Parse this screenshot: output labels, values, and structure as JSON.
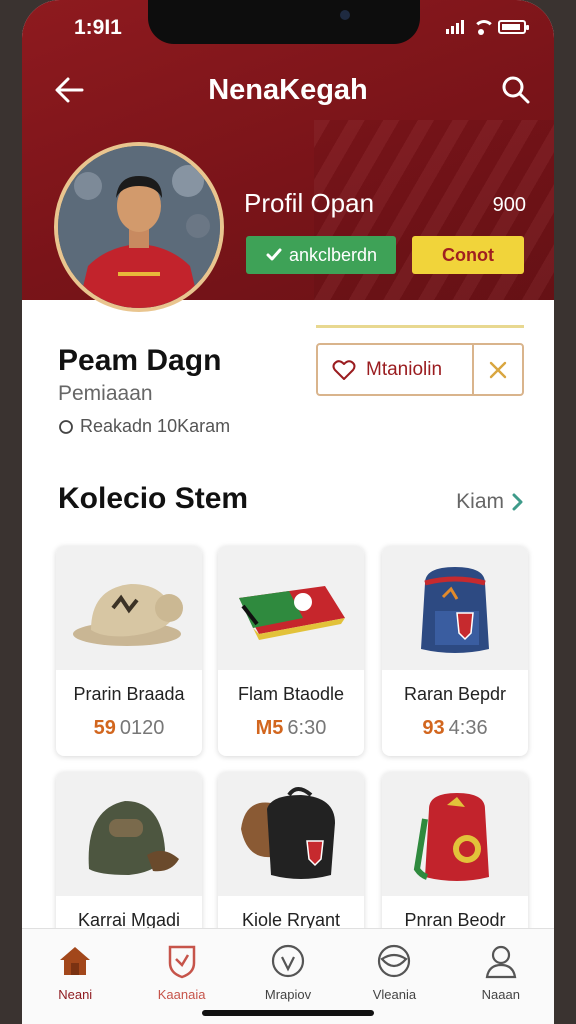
{
  "status": {
    "time": "1:9I1"
  },
  "header": {
    "title": "NenaKegah"
  },
  "profile": {
    "name": "Profil Opan",
    "count": "900",
    "follow_label": "ankclberdn",
    "contact_label": "Conot"
  },
  "shop": {
    "name": "Peam Dagn",
    "subtitle": "Pemiaaan",
    "location": "Reakadn 10Karam",
    "favorite_label": "Mtaniolin"
  },
  "collection": {
    "title": "Kolecio Stem",
    "see_all": "Kiam",
    "items": [
      {
        "name": "Prarin Braada",
        "price_accent": "59",
        "price": "0120",
        "icon": "cap-icon"
      },
      {
        "name": "Flam Btaodle",
        "price_accent": "M5",
        "price": "6:30",
        "icon": "wallet-icon"
      },
      {
        "name": "Raran Bepdr",
        "price_accent": "93",
        "price": "4:36",
        "icon": "backpack-icon"
      },
      {
        "name": "Karrai Mgadi",
        "price_accent": "",
        "price": "",
        "icon": "hat-bag-icon"
      },
      {
        "name": "Kiole Rryant",
        "price_accent": "",
        "price": "",
        "icon": "black-bag-icon"
      },
      {
        "name": "Pnran Beodr",
        "price_accent": "",
        "price": "",
        "icon": "red-backpack-icon"
      }
    ]
  },
  "tabs": [
    {
      "label": "Neani",
      "icon": "home-icon"
    },
    {
      "label": "Kaanaia",
      "icon": "shield-icon"
    },
    {
      "label": "Mrapiov",
      "icon": "check-circle-icon"
    },
    {
      "label": "Vleania",
      "icon": "leaf-icon"
    },
    {
      "label": "Naaan",
      "icon": "user-icon"
    }
  ],
  "colors": {
    "brand": "#8e1a1f",
    "follow": "#3ea257",
    "contact": "#f1d43a",
    "price_accent": "#d2661e"
  }
}
